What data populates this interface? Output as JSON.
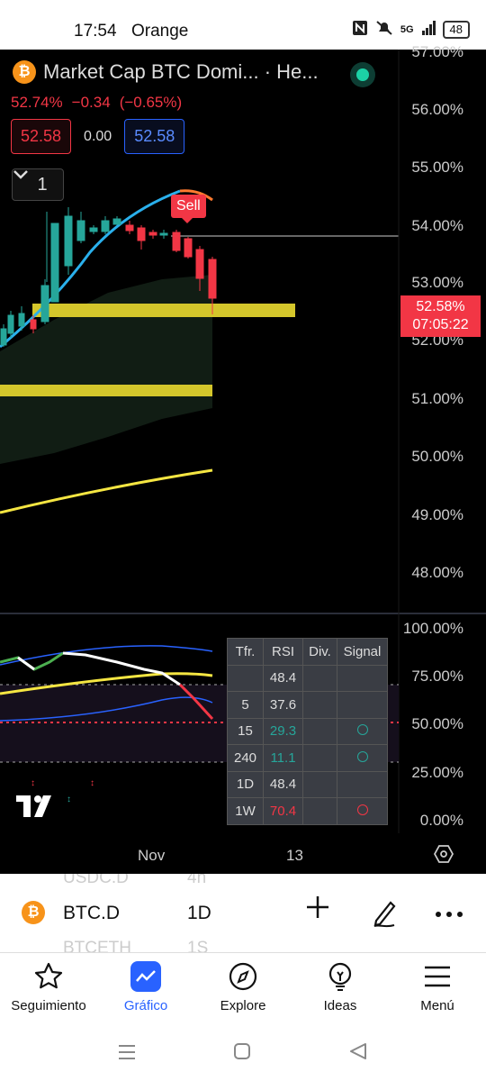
{
  "status_bar": {
    "time": "17:54",
    "carrier": "Orange",
    "network": "5G",
    "battery": "48"
  },
  "chart_header": {
    "coin_letter": "₿",
    "title": "Market Cap BTC Domi... · He...",
    "last": "52.74%",
    "change": "−0.34",
    "change_pct": "(−0.65%)",
    "box_left": "52.58",
    "box_mid": "0.00",
    "box_right": "52.58",
    "collapse_count": "1",
    "sell_label": "Sell"
  },
  "y_axis": {
    "labels": [
      "57.00%",
      "56.00%",
      "55.00%",
      "54.00%",
      "53.00%",
      "52.00%",
      "51.00%",
      "50.00%",
      "49.00%",
      "48.00%"
    ],
    "current_price": "52.58%",
    "countdown": "07:05:22"
  },
  "rsi_axis": {
    "labels": [
      "100.00%",
      "75.00%",
      "50.00%",
      "25.00%",
      "0.00%"
    ]
  },
  "rsi_table": {
    "headers": [
      "Tfr.",
      "RSI",
      "Div.",
      "Signal"
    ],
    "rows": [
      {
        "tf": "",
        "rsi": "48.4",
        "rsi_color": "default",
        "div": "",
        "signal": ""
      },
      {
        "tf": "5",
        "rsi": "37.6",
        "rsi_color": "default",
        "div": "",
        "signal": ""
      },
      {
        "tf": "15",
        "rsi": "29.3",
        "rsi_color": "green",
        "div": "",
        "signal": "green-circle"
      },
      {
        "tf": "240",
        "rsi": "11.1",
        "rsi_color": "green",
        "div": "",
        "signal": "green-circle"
      },
      {
        "tf": "1D",
        "rsi": "48.4",
        "rsi_color": "default",
        "div": "",
        "signal": ""
      },
      {
        "tf": "1W",
        "rsi": "70.4",
        "rsi_color": "red",
        "div": "",
        "signal": "red-circle"
      }
    ]
  },
  "x_axis": {
    "labels": [
      "Nov",
      "13"
    ]
  },
  "symbol_bar": {
    "ghost_above_symbol": "USDC.D",
    "ghost_above_tf": "4h",
    "symbol": "BTC.D",
    "timeframe": "1D",
    "ghost_below_symbol": "BTCETH",
    "ghost_below_tf": "1S"
  },
  "bottom_nav": {
    "items": [
      {
        "label": "Seguimiento",
        "icon": "star-icon"
      },
      {
        "label": "Gráfico",
        "icon": "chart-icon"
      },
      {
        "label": "Explore",
        "icon": "compass-icon"
      },
      {
        "label": "Ideas",
        "icon": "lightbulb-icon"
      },
      {
        "label": "Menú",
        "icon": "menu-icon"
      }
    ],
    "active": "Gráfico"
  },
  "colors": {
    "bear": "#f23645",
    "bull": "#26a69a",
    "accent": "#2962ff",
    "zone": "#d4c62b"
  }
}
